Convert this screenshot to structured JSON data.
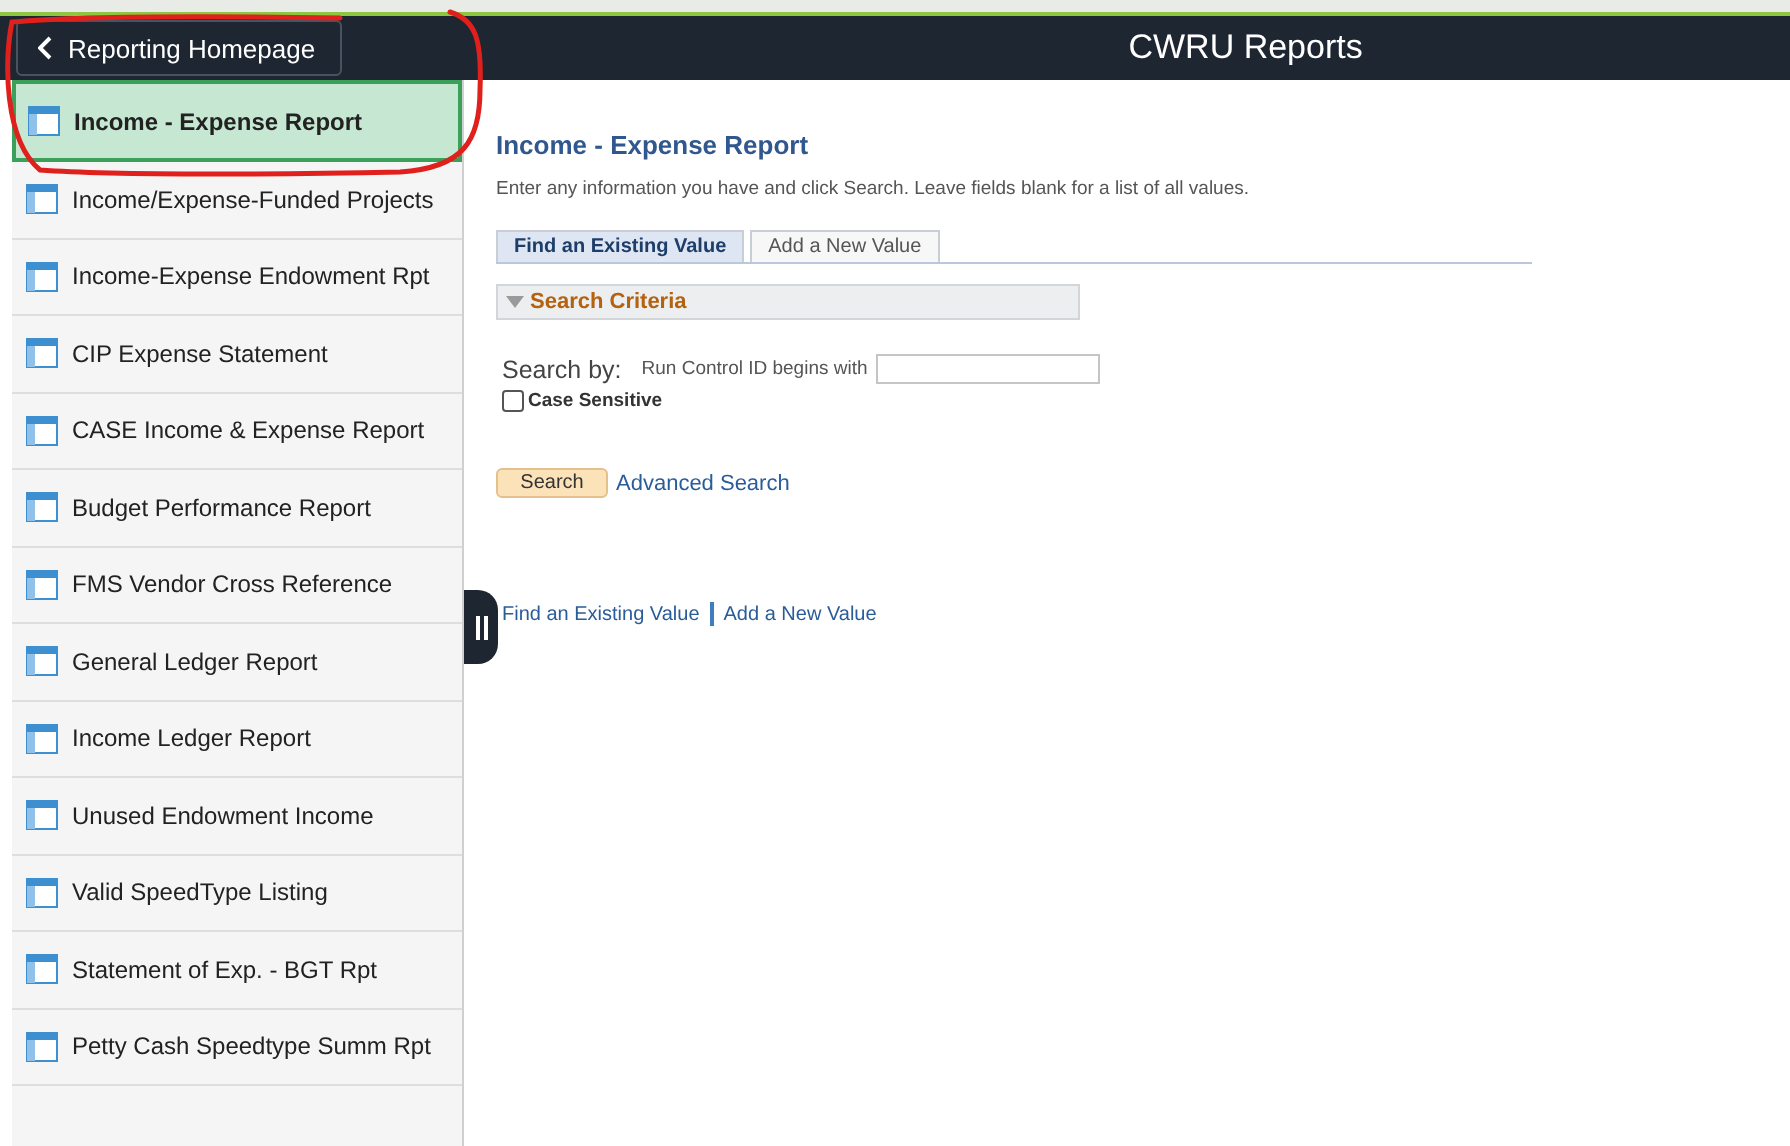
{
  "header": {
    "back_button": "Reporting Homepage",
    "title": "CWRU Reports"
  },
  "sidebar": {
    "items": [
      {
        "label": "Income - Expense Report",
        "selected": true
      },
      {
        "label": "Income/Expense-Funded Projects",
        "selected": false
      },
      {
        "label": "Income-Expense Endowment Rpt",
        "selected": false
      },
      {
        "label": "CIP Expense Statement",
        "selected": false
      },
      {
        "label": "CASE Income & Expense Report",
        "selected": false
      },
      {
        "label": "Budget Performance Report",
        "selected": false
      },
      {
        "label": "FMS Vendor Cross Reference",
        "selected": false
      },
      {
        "label": "General Ledger Report",
        "selected": false
      },
      {
        "label": "Income Ledger Report",
        "selected": false
      },
      {
        "label": "Unused Endowment Income",
        "selected": false
      },
      {
        "label": "Valid SpeedType Listing",
        "selected": false
      },
      {
        "label": "Statement of Exp. - BGT Rpt",
        "selected": false
      },
      {
        "label": "Petty Cash Speedtype Summ Rpt",
        "selected": false
      }
    ]
  },
  "page": {
    "title": "Income - Expense Report",
    "instructions": "Enter any information you have and click Search. Leave fields blank for a list of all values.",
    "tabs": [
      {
        "label": "Find an Existing Value",
        "selected": true
      },
      {
        "label": "Add a New Value",
        "selected": false
      }
    ],
    "section": {
      "title": "Search Criteria",
      "expanded": true
    },
    "search_by_label": "Search by:",
    "field_label": "Run Control ID begins with",
    "case_sensitive": {
      "label": "Case Sensitive",
      "checked": false
    },
    "search_button": "Search",
    "advanced_link": "Advanced Search",
    "bottom_links": [
      "Find an Existing Value",
      "Add a New Value"
    ]
  }
}
